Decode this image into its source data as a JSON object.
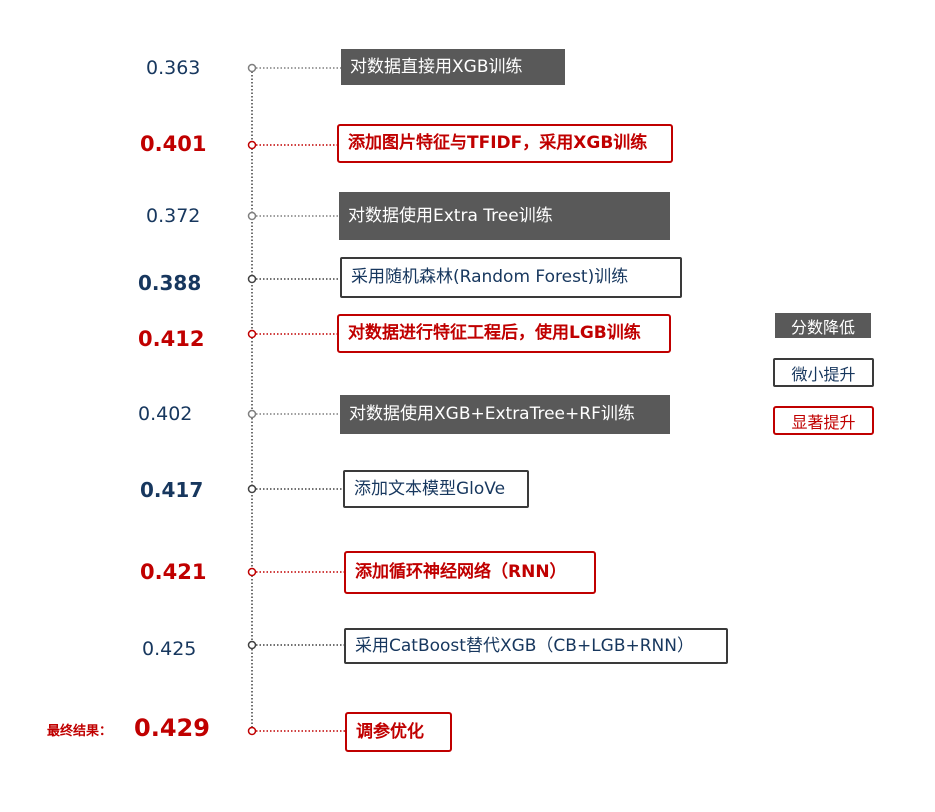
{
  "steps": [
    {
      "score": "0.363",
      "label": "对数据直接用XGB训练",
      "type": "decrease"
    },
    {
      "score": "0.401",
      "label": "添加图片特征与TFIDF，采用XGB训练",
      "type": "big"
    },
    {
      "score": "0.372",
      "label": "对数据使用Extra Tree训练",
      "type": "decrease"
    },
    {
      "score": "0.388",
      "label": "采用随机森林(Random Forest)训练",
      "type": "small"
    },
    {
      "score": "0.412",
      "label": "对数据进行特征工程后，使用LGB训练",
      "type": "big"
    },
    {
      "score": "0.402",
      "label": "对数据使用XGB+ExtraTree+RF训练",
      "type": "decrease"
    },
    {
      "score": "0.417",
      "label": "添加文本模型GloVe",
      "type": "small"
    },
    {
      "score": "0.421",
      "label": "添加循环神经网络（RNN）",
      "type": "big"
    },
    {
      "score": "0.425",
      "label": "采用CatBoost替代XGB（CB+LGB+RNN）",
      "type": "small"
    },
    {
      "score": "0.429",
      "label": "调参优化",
      "type": "big"
    }
  ],
  "final_label": "最终结果：",
  "legend": {
    "decrease": "分数降低",
    "small": "微小提升",
    "big": "显著提升"
  },
  "colors": {
    "decrease_fill": "#595959",
    "small_border": "#3a3a3a",
    "big_border": "#c00000",
    "text_navy": "#17375e",
    "text_red": "#c00000"
  }
}
